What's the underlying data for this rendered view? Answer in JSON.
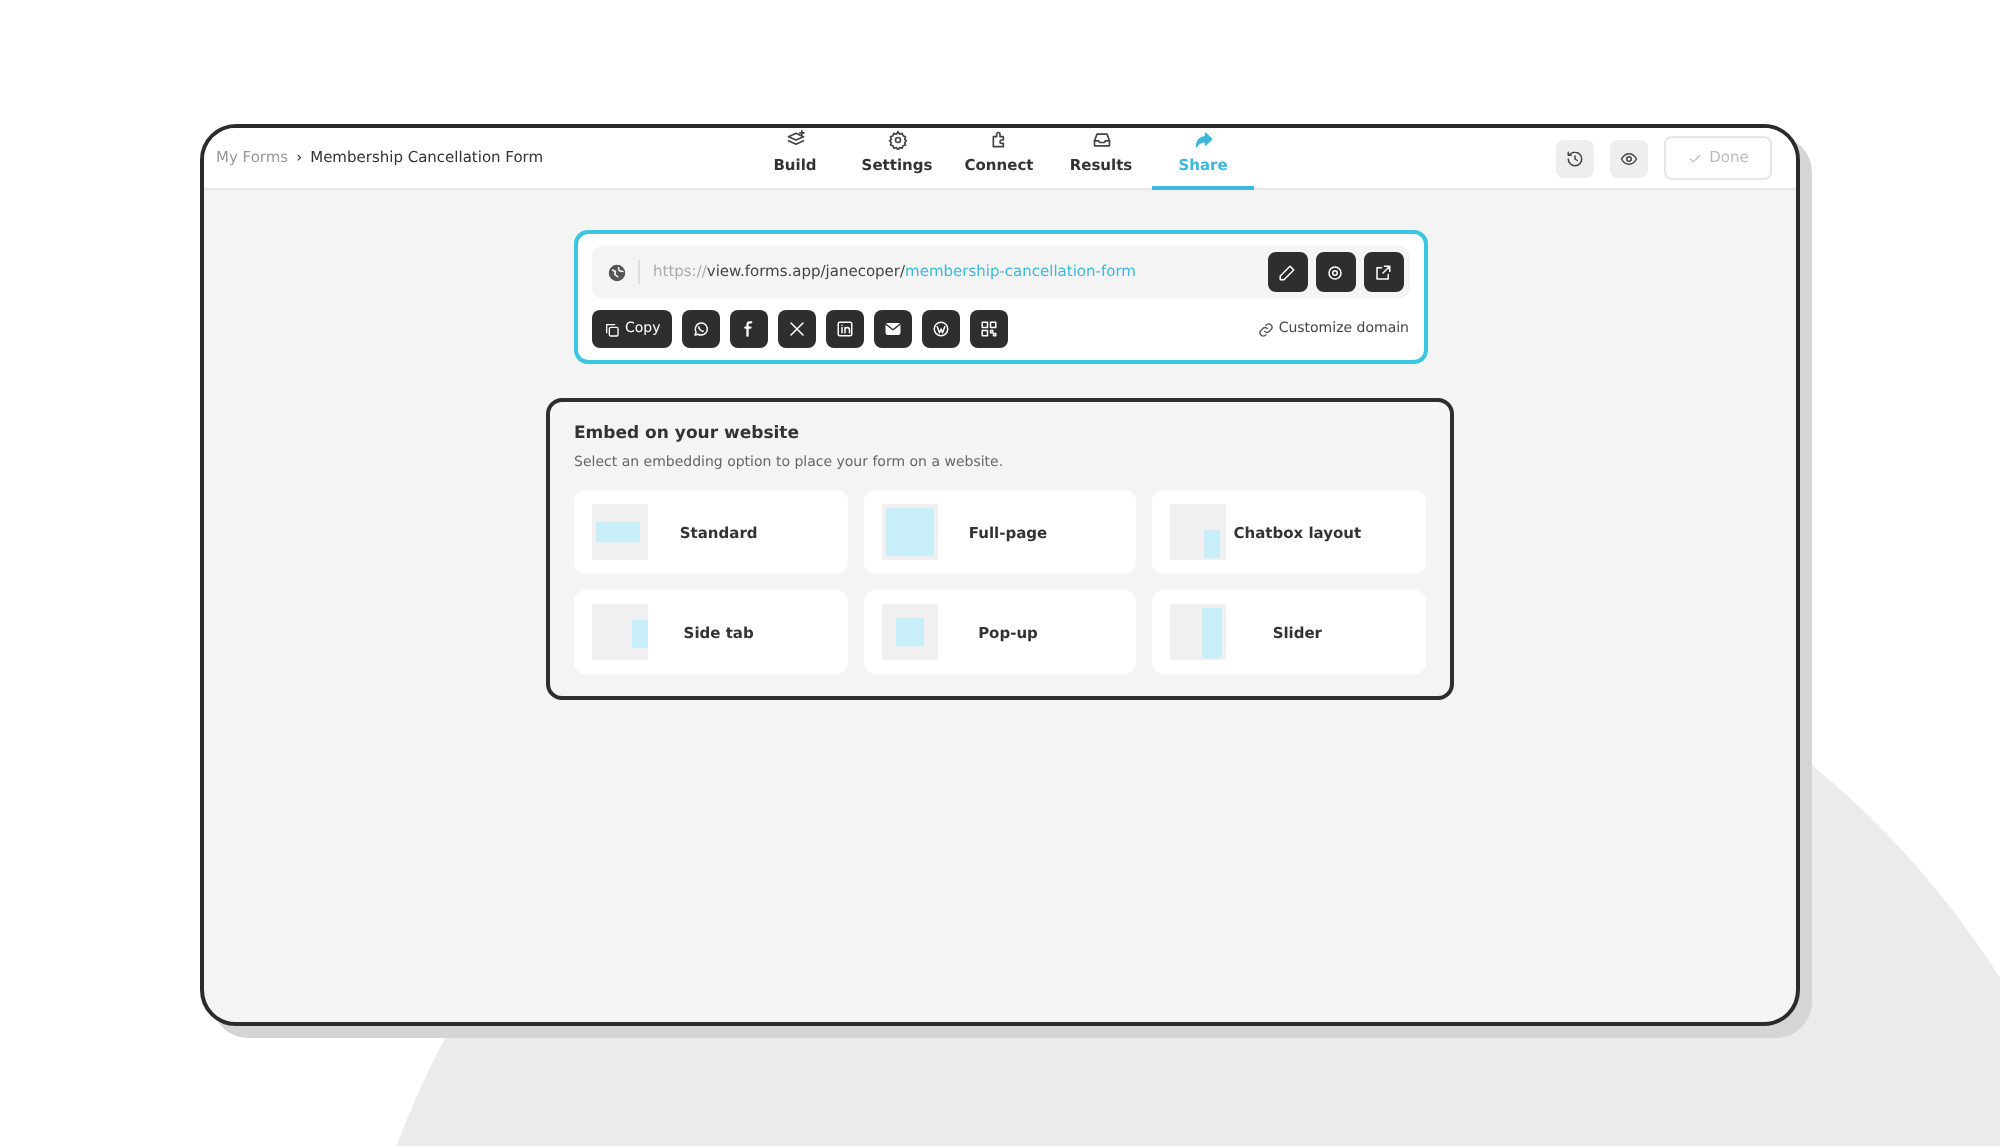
{
  "breadcrumb": {
    "parent": "My Forms",
    "separator": "›",
    "current": "Membership Cancellation Form"
  },
  "tabs": [
    {
      "label": "Build",
      "kind": "build",
      "selected": false
    },
    {
      "label": "Settings",
      "kind": "settings",
      "selected": false
    },
    {
      "label": "Connect",
      "kind": "connect",
      "selected": false
    },
    {
      "label": "Results",
      "kind": "results",
      "selected": false
    },
    {
      "label": "Share",
      "kind": "share",
      "selected": true
    }
  ],
  "header_actions": [
    {
      "kind": "history"
    },
    {
      "kind": "preview"
    }
  ],
  "done_button": {
    "label": "Done",
    "disabled": true
  },
  "share_link": {
    "scheme": "https://",
    "base": "view.forms.app/janecoper/",
    "slug": "membership-cancellation-form",
    "url_actions": [
      {
        "kind": "edit"
      },
      {
        "kind": "settings"
      },
      {
        "kind": "open"
      }
    ],
    "copy_label": "Copy",
    "share_buttons": [
      {
        "kind": "whatsapp"
      },
      {
        "kind": "facebook"
      },
      {
        "kind": "x"
      },
      {
        "kind": "linkedin"
      },
      {
        "kind": "email"
      },
      {
        "kind": "wordpress"
      },
      {
        "kind": "qr"
      }
    ],
    "customize_label": "Customize domain"
  },
  "embed": {
    "title": "Embed on your website",
    "subtitle": "Select an embedding option to place your form on a website.",
    "options": [
      {
        "label": "Standard",
        "kind": "standard"
      },
      {
        "label": "Full-page",
        "kind": "full"
      },
      {
        "label": "Chatbox layout",
        "kind": "chatbox"
      },
      {
        "label": "Side tab",
        "kind": "sidetab"
      },
      {
        "label": "Pop-up",
        "kind": "popup"
      },
      {
        "label": "Slider",
        "kind": "slider"
      }
    ]
  }
}
